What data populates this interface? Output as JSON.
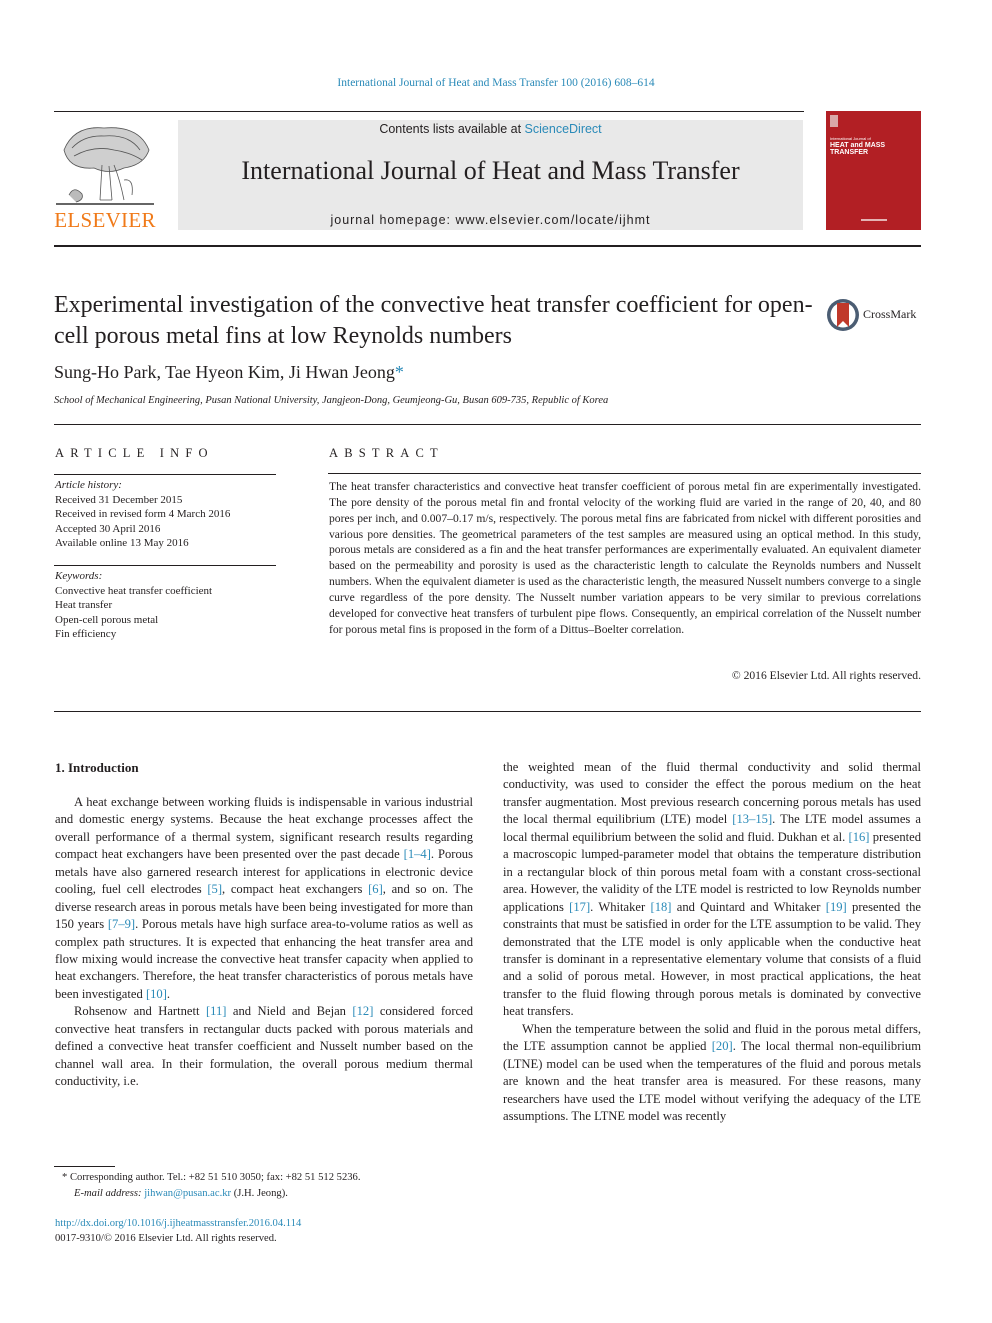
{
  "header": {
    "running_head": "International Journal of Heat and Mass Transfer 100 (2016) 608–614",
    "contents_prefix": "Contents lists available at ",
    "contents_link": "ScienceDirect",
    "journal_name": "International Journal of Heat and Mass Transfer",
    "homepage": "journal homepage: www.elsevier.com/locate/ijhmt",
    "publisher_logo": "ELSEVIER",
    "cover": {
      "small_line": "International Journal of",
      "title_line1": "HEAT and MASS",
      "title_line2": "TRANSFER",
      "color": "#b21f24"
    }
  },
  "article": {
    "title": "Experimental investigation of the convective heat transfer coefficient for open-cell porous metal fins at low Reynolds numbers",
    "crossmark_label": "CrossMark",
    "authors": "Sung-Ho Park, Tae Hyeon Kim, Ji Hwan Jeong",
    "corresponding_mark": "*",
    "affiliation": "School of Mechanical Engineering, Pusan National University, Jangjeon-Dong, Geumjeong-Gu, Busan 609-735, Republic of Korea"
  },
  "article_info": {
    "heading": "ARTICLE INFO",
    "history_label": "Article history:",
    "history": [
      "Received 31 December 2015",
      "Received in revised form 4 March 2016",
      "Accepted 30 April 2016",
      "Available online 13 May 2016"
    ],
    "keywords_label": "Keywords:",
    "keywords": [
      "Convective heat transfer coefficient",
      "Heat transfer",
      "Open-cell porous metal",
      "Fin efficiency"
    ]
  },
  "abstract": {
    "heading": "ABSTRACT",
    "text": "The heat transfer characteristics and convective heat transfer coefficient of porous metal fin are experimentally investigated. The pore density of the porous metal fin and frontal velocity of the working fluid are varied in the range of 20, 40, and 80 pores per inch, and 0.007–0.17 m/s, respectively. The porous metal fins are fabricated from nickel with different porosities and various pore densities. The geometrical parameters of the test samples are measured using an optical method. In this study, porous metals are considered as a fin and the heat transfer performances are experimentally evaluated. An equivalent diameter based on the permeability and porosity is used as the characteristic length to calculate the Reynolds numbers and Nusselt numbers. When the equivalent diameter is used as the characteristic length, the measured Nusselt numbers converge to a single curve regardless of the pore density. The Nusselt number variation appears to be very similar to previous correlations developed for convective heat transfers of turbulent pipe flows. Consequently, an empirical correlation of the Nusselt number for porous metal fins is proposed in the form of a Dittus–Boelter correlation.",
    "copyright": "© 2016 Elsevier Ltd. All rights reserved."
  },
  "body": {
    "section_heading": "1. Introduction",
    "left_p1": [
      {
        "t": "A heat exchange between working fluids is indispensable in various industrial and domestic energy systems. Because the heat exchange processes affect the overall performance of a thermal system, significant research results regarding compact heat exchangers have been presented over the past decade "
      },
      {
        "ref": "[1–4]"
      },
      {
        "t": ". Porous metals have also garnered research interest for applications in electronic device cooling, fuel cell electrodes "
      },
      {
        "ref": "[5]"
      },
      {
        "t": ", compact heat exchangers "
      },
      {
        "ref": "[6]"
      },
      {
        "t": ", and so on. The diverse research areas in porous metals have been being investigated for more than 150 years "
      },
      {
        "ref": "[7–9]"
      },
      {
        "t": ". Porous metals have high surface area-to-volume ratios as well as complex path structures. It is expected that enhancing the heat transfer area and flow mixing would increase the convective heat transfer capacity when applied to heat exchangers. Therefore, the heat transfer characteristics of porous metals have been investigated "
      },
      {
        "ref": "[10]"
      },
      {
        "t": "."
      }
    ],
    "left_p2": [
      {
        "t": "Rohsenow and Hartnett "
      },
      {
        "ref": "[11]"
      },
      {
        "t": " and Nield and Bejan "
      },
      {
        "ref": "[12]"
      },
      {
        "t": " considered forced convective heat transfers in rectangular ducts packed with porous materials and defined a convective heat transfer coefficient and Nusselt number based on the channel wall area. In their formulation, the overall porous medium thermal conductivity, i.e."
      }
    ],
    "right_p1": [
      {
        "t": "the weighted mean of the fluid thermal conductivity and solid thermal conductivity, was used to consider the effect the porous medium on the heat transfer augmentation. Most previous research concerning porous metals has used the local thermal equilibrium (LTE) model "
      },
      {
        "ref": "[13–15]"
      },
      {
        "t": ". The LTE model assumes a local thermal equilibrium between the solid and fluid. Dukhan et al. "
      },
      {
        "ref": "[16]"
      },
      {
        "t": " presented a macroscopic lumped-parameter model that obtains the temperature distribution in a rectangular block of thin porous metal foam with a constant cross-sectional area. However, the validity of the LTE model is restricted to low Reynolds number applications "
      },
      {
        "ref": "[17]"
      },
      {
        "t": ". Whitaker "
      },
      {
        "ref": "[18]"
      },
      {
        "t": " and Quintard and Whitaker "
      },
      {
        "ref": "[19]"
      },
      {
        "t": " presented the constraints that must be satisfied in order for the LTE assumption to be valid. They demonstrated that the LTE model is only applicable when the conductive heat transfer is dominant in a representative elementary volume that consists of a fluid and a solid of porous metal. However, in most practical applications, the heat transfer to the fluid flowing through porous metals is dominated by convective heat transfers."
      }
    ],
    "right_p2": [
      {
        "t": "When the temperature between the solid and fluid in the porous metal differs, the LTE assumption cannot be applied "
      },
      {
        "ref": "[20]"
      },
      {
        "t": ". The local thermal non-equilibrium (LTNE) model can be used when the temperatures of the fluid and porous metals are known and the heat transfer area is measured. For these reasons, many researchers have used the LTE model without verifying the adequacy of the LTE assumptions. The LTNE model was recently"
      }
    ]
  },
  "footnote": {
    "mark": "*",
    "corresponding": "Corresponding author. Tel.: +82 51 510 3050; fax: +82 51 512 5236.",
    "email_label": "E-mail address:",
    "email": "jihwan@pusan.ac.kr",
    "email_suffix": " (J.H. Jeong)."
  },
  "doi": {
    "url": "http://dx.doi.org/10.1016/j.ijheatmasstransfer.2016.04.114",
    "issn_line": "0017-9310/© 2016 Elsevier Ltd. All rights reserved."
  },
  "colors": {
    "link": "#2a8ab8",
    "elsevier_orange": "#f07a19",
    "banner_gray": "#e9e9e9",
    "cover_red": "#b21f24"
  }
}
